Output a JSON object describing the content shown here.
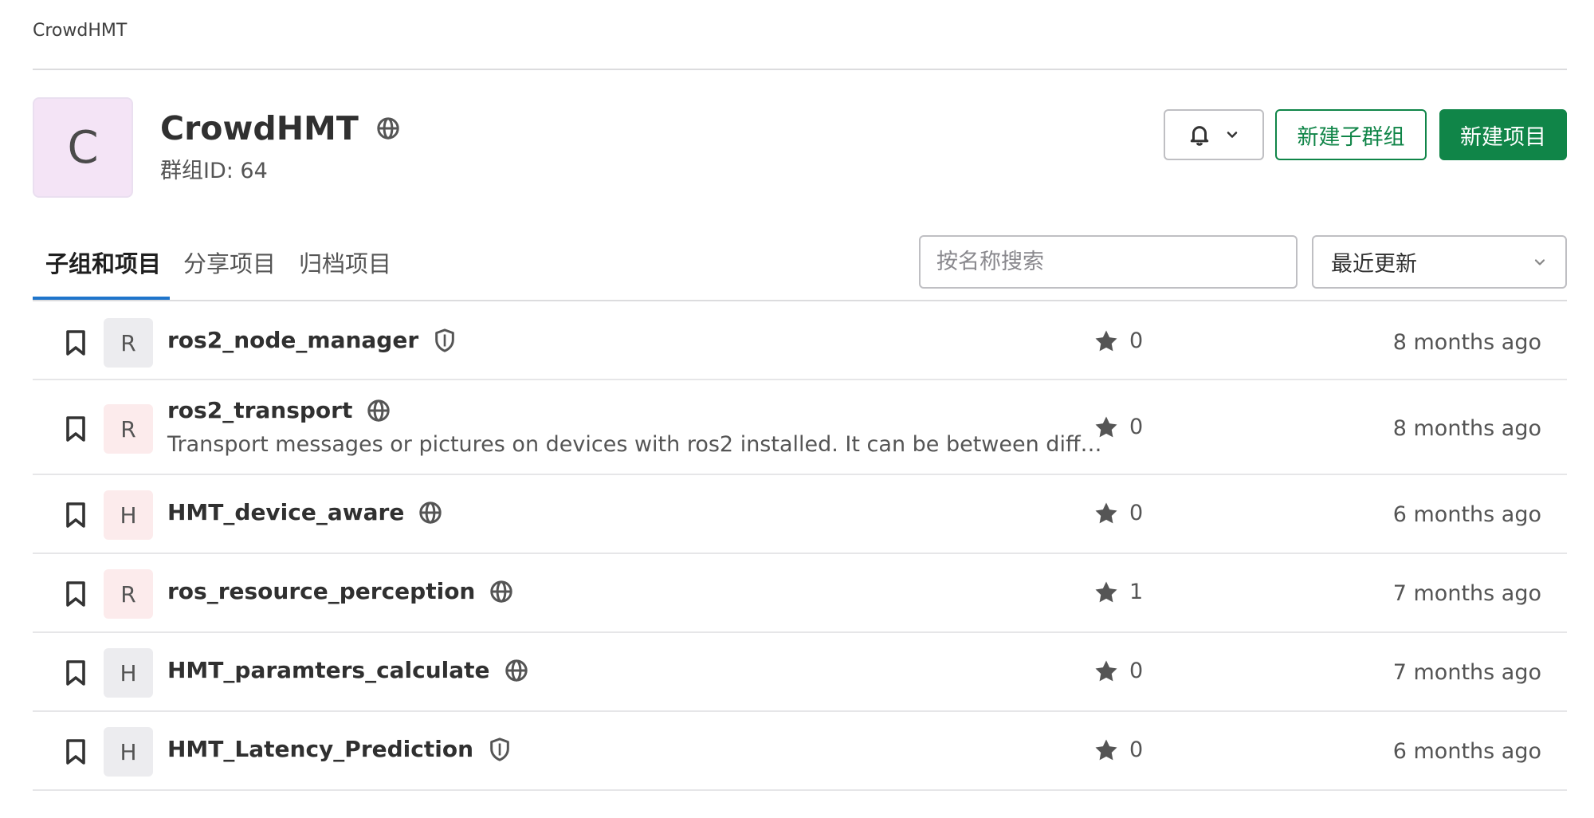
{
  "breadcrumb": "CrowdHMT",
  "group": {
    "avatar_letter": "C",
    "name": "CrowdHMT",
    "id_label": "群组ID: 64"
  },
  "actions": {
    "new_subgroup": "新建子群组",
    "new_project": "新建项目"
  },
  "tabs": [
    {
      "label": "子组和项目",
      "active": true
    },
    {
      "label": "分享项目",
      "active": false
    },
    {
      "label": "归档项目",
      "active": false
    }
  ],
  "search": {
    "placeholder": "按名称搜索"
  },
  "sort": {
    "selected": "最近更新"
  },
  "projects": [
    {
      "letter": "R",
      "name": "ros2_node_manager",
      "visibility": "internal",
      "description": "",
      "stars": "0",
      "updated": "8 months ago"
    },
    {
      "letter": "R",
      "name": "ros2_transport",
      "visibility": "public",
      "description": "Transport messages or pictures on devices with ros2 installed. It can be between diff…",
      "stars": "0",
      "updated": "8 months ago"
    },
    {
      "letter": "H",
      "name": "HMT_device_aware",
      "visibility": "public",
      "description": "",
      "stars": "0",
      "updated": "6 months ago"
    },
    {
      "letter": "R",
      "name": "ros_resource_perception",
      "visibility": "public",
      "description": "",
      "stars": "1",
      "updated": "7 months ago"
    },
    {
      "letter": "H",
      "name": "HMT_paramters_calculate",
      "visibility": "public",
      "description": "",
      "stars": "0",
      "updated": "7 months ago"
    },
    {
      "letter": "H",
      "name": "HMT_Latency_Prediction",
      "visibility": "internal",
      "description": "",
      "stars": "0",
      "updated": "6 months ago"
    }
  ],
  "colors": {
    "primary_green": "#108548",
    "tab_active": "#1f75cb",
    "group_avatar_bg": "#f4e4f6",
    "avatar_grey": "#ececef",
    "avatar_pink": "#fcebec"
  }
}
